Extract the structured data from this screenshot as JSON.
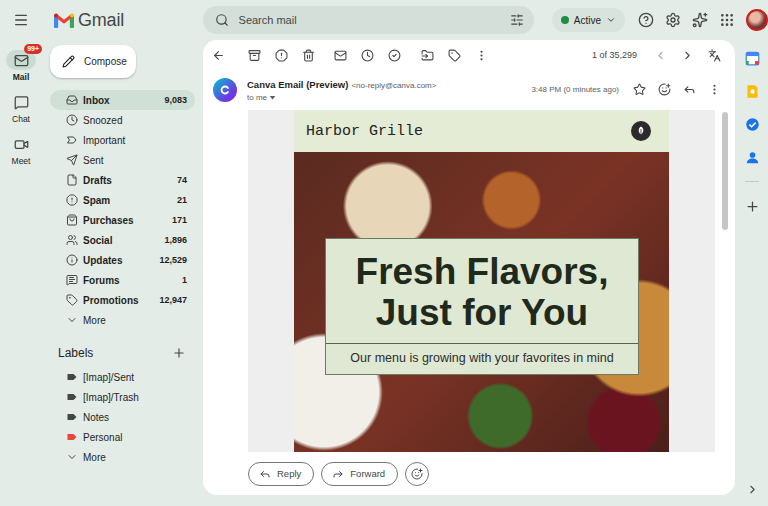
{
  "app": {
    "name": "Gmail"
  },
  "search": {
    "placeholder": "Search mail"
  },
  "status": {
    "label": "Active",
    "online": true
  },
  "rail": [
    {
      "label": "Mail",
      "badge": "99+",
      "selected": true
    },
    {
      "label": "Chat",
      "badge": "",
      "selected": false
    },
    {
      "label": "Meet",
      "badge": "",
      "selected": false
    }
  ],
  "sidebar": {
    "compose": "Compose",
    "folders": [
      {
        "label": "Inbox",
        "count": "9,083",
        "selected": true,
        "unread": true
      },
      {
        "label": "Snoozed",
        "count": "",
        "selected": false,
        "unread": false
      },
      {
        "label": "Important",
        "count": "",
        "selected": false,
        "unread": false
      },
      {
        "label": "Sent",
        "count": "",
        "selected": false,
        "unread": false
      },
      {
        "label": "Drafts",
        "count": "74",
        "selected": false,
        "unread": true
      },
      {
        "label": "Spam",
        "count": "21",
        "selected": false,
        "unread": true
      },
      {
        "label": "Purchases",
        "count": "171",
        "selected": false,
        "unread": true
      },
      {
        "label": "Social",
        "count": "1,896",
        "selected": false,
        "unread": true
      },
      {
        "label": "Updates",
        "count": "12,529",
        "selected": false,
        "unread": true
      },
      {
        "label": "Forums",
        "count": "1",
        "selected": false,
        "unread": true
      },
      {
        "label": "Promotions",
        "count": "12,947",
        "selected": false,
        "unread": true
      }
    ],
    "more": "More"
  },
  "labels": {
    "title": "Labels",
    "items": [
      {
        "label": "[Imap]/Sent",
        "color": "#444746"
      },
      {
        "label": "[Imap]/Trash",
        "color": "#444746"
      },
      {
        "label": "Notes",
        "color": "#444746"
      },
      {
        "label": "Personal",
        "color": "#e8453c"
      }
    ],
    "more": "More"
  },
  "toolbar": {
    "pager": "1 of 35,299"
  },
  "message": {
    "sender": "Canva Email (Preview)",
    "address": "<no-reply@canva.com>",
    "recipient": "to me",
    "time": "3:48 PM (0 minutes ago)",
    "starred": false
  },
  "email": {
    "brand": "Harbor Grille",
    "headline": [
      "Fresh Flavors,",
      "Just for You"
    ],
    "subline": "Our menu is growing with your favorites in mind"
  },
  "actions": [
    "Reply",
    "Forward"
  ]
}
